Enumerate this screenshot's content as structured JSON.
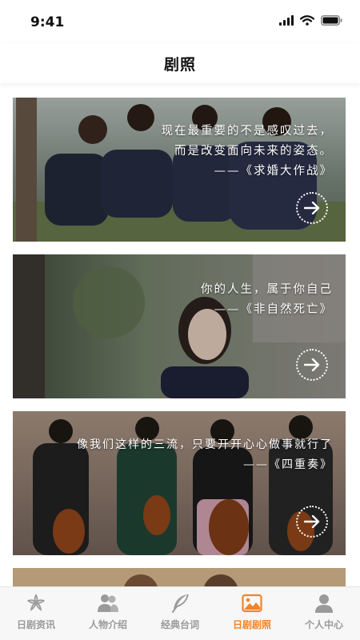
{
  "status_bar": {
    "time": "9:41"
  },
  "header": {
    "title": "剧照"
  },
  "cards": [
    {
      "lines": [
        "现在最重要的不是感叹过去，",
        "而是改变面向未来的姿态。",
        "——《求婚大作战》"
      ]
    },
    {
      "lines": [
        "你的人生，属于你自己",
        "——《非自然死亡》"
      ]
    },
    {
      "lines": [
        "像我们这样的三流，只要开开心心做事就行了",
        "——《四重奏》"
      ]
    }
  ],
  "tab_bar": {
    "tabs": [
      {
        "label": "日剧资讯",
        "icon": "sakura-icon"
      },
      {
        "label": "人物介绍",
        "icon": "people-icon"
      },
      {
        "label": "经典台词",
        "icon": "feather-icon"
      },
      {
        "label": "日剧剧照",
        "icon": "photo-icon",
        "active": true
      },
      {
        "label": "个人中心",
        "icon": "person-icon"
      }
    ]
  },
  "colors": {
    "accent": "#f0842a",
    "inactive": "#9a9a9a"
  }
}
